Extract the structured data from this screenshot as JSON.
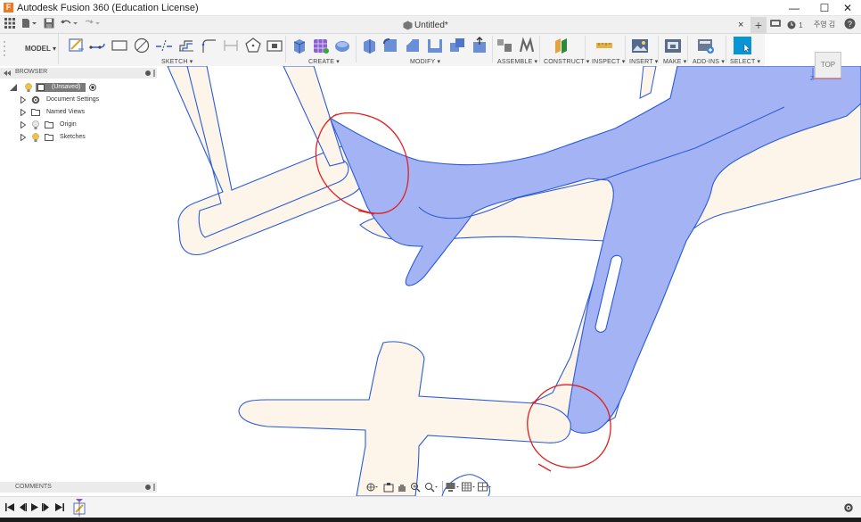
{
  "titlebar": {
    "app_title": "Autodesk Fusion 360 (Education License)",
    "logo_letter": "F",
    "minimize": "—",
    "maximize": "☐",
    "close": "✕"
  },
  "tabs": {
    "document_title": "Untitled*",
    "close_glyph": "×",
    "add_glyph": "+",
    "status_count": "1",
    "user_name": "주영 김",
    "help_glyph": "?"
  },
  "toolbar": {
    "workspace": "MODEL ▾",
    "groups": {
      "sketch": "SKETCH ▾",
      "create": "CREATE ▾",
      "modify": "MODIFY ▾",
      "assemble": "ASSEMBLE ▾",
      "construct": "CONSTRUCT ▾",
      "inspect": "INSPECT ▾",
      "insert": "INSERT ▾",
      "make": "MAKE ▾",
      "addins": "ADD-INS ▾",
      "select": "SELECT ▾"
    }
  },
  "browser": {
    "title": "BROWSER",
    "root": "(Unsaved)",
    "items": [
      {
        "label": "Document Settings",
        "icon": "gear-icon"
      },
      {
        "label": "Named Views",
        "icon": "folder-icon"
      },
      {
        "label": "Origin",
        "icon": "folder-icon"
      },
      {
        "label": "Sketches",
        "icon": "folder-icon"
      }
    ]
  },
  "comments": {
    "title": "COMMENTS"
  },
  "viewcube": {
    "face": "TOP",
    "axis_z": "Z",
    "axis_x": "X"
  },
  "colors": {
    "profile_fill": "#fdf5ea",
    "sketch_line": "#2a5bd7",
    "selected_fill": "#a4b3f3",
    "annotation_red": "#e02020",
    "select_accent": "#0696d7"
  }
}
